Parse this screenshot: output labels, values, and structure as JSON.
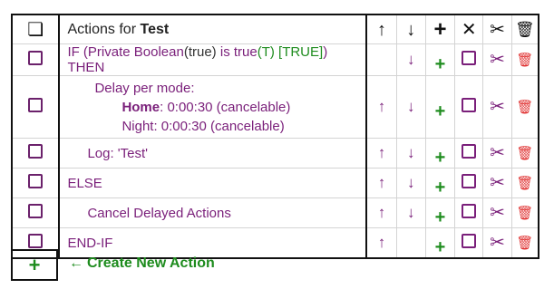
{
  "header": {
    "title_prefix": "Actions for",
    "title_name": "Test",
    "icons": [
      "copy-icon",
      "arrow-up-icon",
      "arrow-down-icon",
      "plus-icon",
      "x-icon",
      "scissors-icon",
      "trash-icon"
    ]
  },
  "symbols": {
    "up": "↑",
    "down": "↓",
    "plus": "+",
    "x": "✕",
    "scissors": "✂",
    "trash": "🗑",
    "copy": "❏",
    "left_arrow": "←"
  },
  "rows": [
    {
      "parts": [
        {
          "text": "IF (Private Boolean",
          "color": "purple"
        },
        {
          "text": "(true)",
          "color": "dark"
        },
        {
          "text": " is true",
          "color": "purple"
        },
        {
          "text": "(T) [TRUE]",
          "color": "green"
        },
        {
          "text": ") THEN",
          "color": "purple"
        }
      ]
    },
    {
      "line1": "Delay per mode:",
      "line2_bold": "Home",
      "line2_rest": ": 0:00:30 (cancelable)",
      "line3": "Night: 0:00:30 (cancelable)"
    },
    {
      "text": "Log: 'Test'"
    },
    {
      "text": "ELSE"
    },
    {
      "text": "Cancel Delayed Actions"
    },
    {
      "text": "END-IF"
    }
  ],
  "footer": {
    "create_label": "Create New Action"
  },
  "colors": {
    "purple": "#7a1f7a",
    "green": "#1e8c1e",
    "red": "#e03030"
  }
}
